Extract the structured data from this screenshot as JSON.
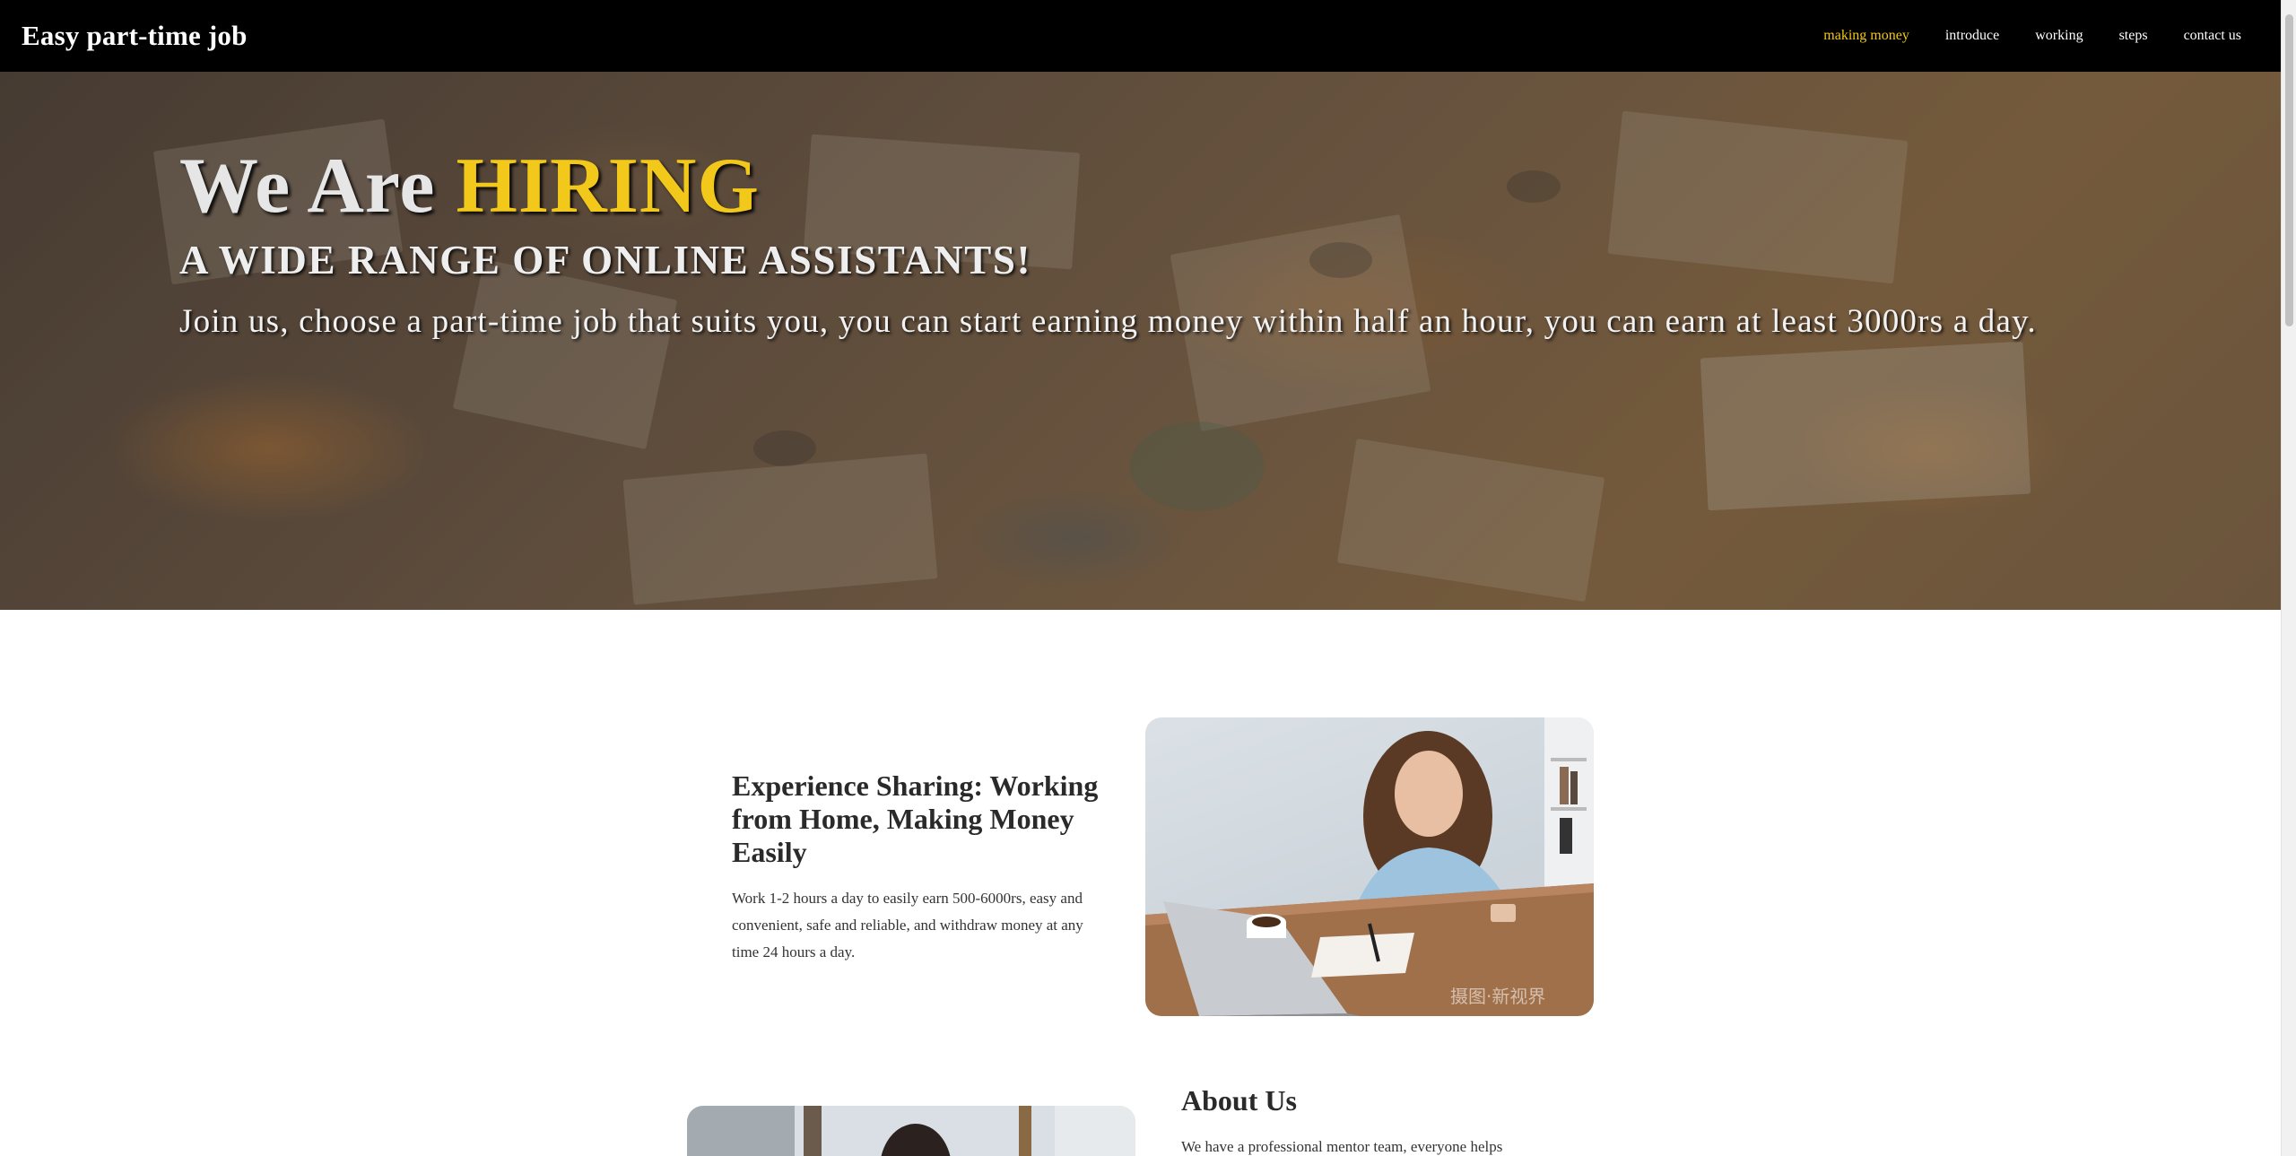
{
  "nav": {
    "brand": "Easy part-time job",
    "links": [
      {
        "label": "making money",
        "active": true
      },
      {
        "label": "introduce"
      },
      {
        "label": "working"
      },
      {
        "label": "steps"
      },
      {
        "label": "contact us"
      }
    ]
  },
  "hero": {
    "title_prefix": "We Are ",
    "title_highlight": "HIRING",
    "subtitle": "A WIDE RANGE OF ONLINE ASSISTANTS!",
    "text": "Join us, choose a part-time job that suits you, you can start earning money within half an hour, you can earn at least 3000rs a day."
  },
  "experience": {
    "title": "Experience Sharing: Working from Home, Making Money Easily",
    "body": "Work 1-2 hours a day to easily earn 500-6000rs, easy and convenient, safe and reliable, and withdraw money at any time 24 hours a day."
  },
  "about": {
    "title": "About Us",
    "body": "We have a professional mentor team, everyone helps"
  },
  "images": {
    "photo_watermark": "摄图·新视界"
  },
  "colors": {
    "accent": "#f2c81a",
    "navbar": "#000000",
    "text_dark": "#2a2a2a"
  }
}
